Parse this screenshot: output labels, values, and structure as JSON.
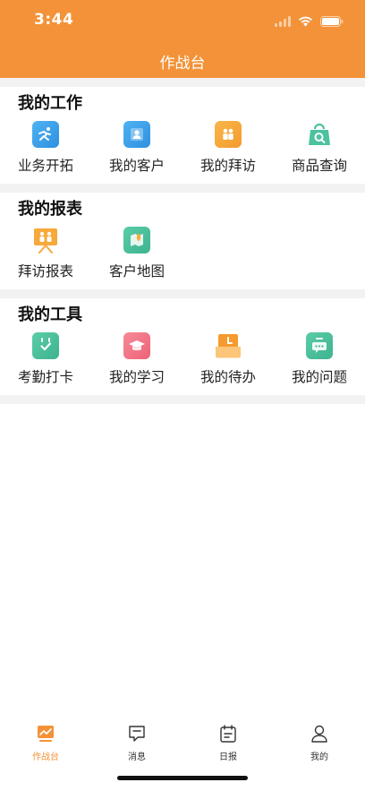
{
  "status": {
    "time": "3:44"
  },
  "nav": {
    "title": "作战台"
  },
  "sections": [
    {
      "title": "我的工作",
      "items": [
        {
          "label": "业务开拓",
          "icon": "running-person-icon"
        },
        {
          "label": "我的客户",
          "icon": "customer-card-icon"
        },
        {
          "label": "我的拜访",
          "icon": "visit-people-icon"
        },
        {
          "label": "商品查询",
          "icon": "shopping-bag-search-icon"
        }
      ]
    },
    {
      "title": "我的报表",
      "items": [
        {
          "label": "拜访报表",
          "icon": "presentation-board-icon"
        },
        {
          "label": "客户地图",
          "icon": "map-pin-icon"
        }
      ]
    },
    {
      "title": "我的工具",
      "items": [
        {
          "label": "考勤打卡",
          "icon": "calendar-check-icon"
        },
        {
          "label": "我的学习",
          "icon": "graduation-cap-icon"
        },
        {
          "label": "我的待办",
          "icon": "clock-todo-icon"
        },
        {
          "label": "我的问题",
          "icon": "chat-bubble-icon"
        }
      ]
    }
  ],
  "tabbar": [
    {
      "label": "作战台",
      "icon": "dashboard-icon",
      "active": true
    },
    {
      "label": "消息",
      "icon": "message-icon",
      "active": false
    },
    {
      "label": "日报",
      "icon": "daily-report-icon",
      "active": false
    },
    {
      "label": "我的",
      "icon": "profile-icon",
      "active": false
    }
  ],
  "colors": {
    "accent": "#F39238",
    "background_gap": "#F2F2F2",
    "blue": "#3AA0EB",
    "orange": "#F7A93B",
    "green": "#4CC2A0",
    "pink": "#F07585"
  }
}
